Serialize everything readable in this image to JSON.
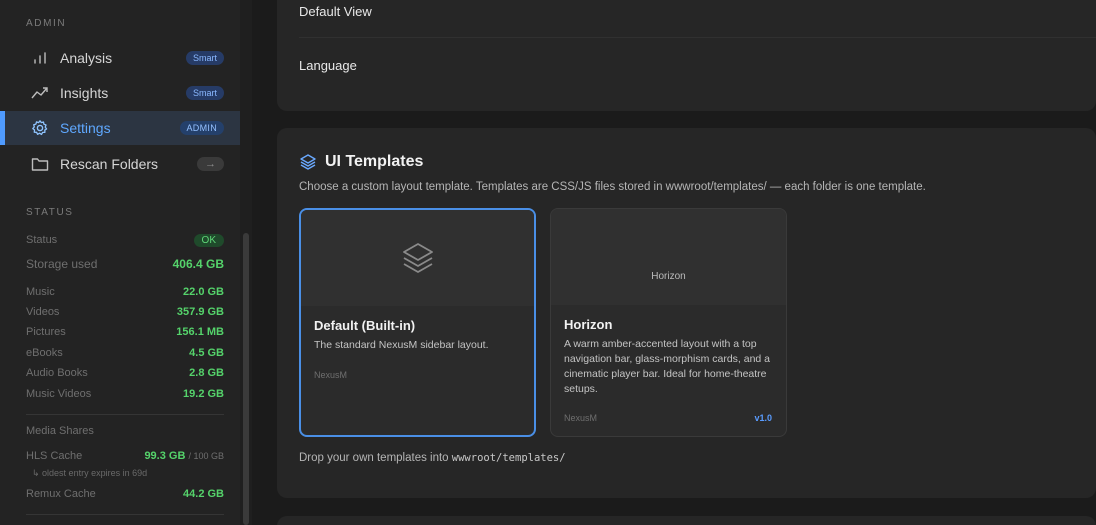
{
  "sidebar": {
    "admin_title": "ADMIN",
    "nav": [
      {
        "label": "Analysis",
        "badge": "Smart",
        "icon": "bar-chart-icon"
      },
      {
        "label": "Insights",
        "badge": "Smart",
        "icon": "trend-icon"
      },
      {
        "label": "Settings",
        "badge": "ADMIN",
        "icon": "gear-icon",
        "active": true
      },
      {
        "label": "Rescan Folders",
        "badge": "→",
        "icon": "folder-icon"
      }
    ],
    "status_title": "STATUS",
    "status": {
      "label": "Status",
      "value": "OK"
    },
    "storage": {
      "label": "Storage used",
      "value": "406.4 GB"
    },
    "breakdown": [
      {
        "label": "Music",
        "value": "22.0 GB"
      },
      {
        "label": "Videos",
        "value": "357.9 GB"
      },
      {
        "label": "Pictures",
        "value": "156.1 MB"
      },
      {
        "label": "eBooks",
        "value": "4.5 GB"
      },
      {
        "label": "Audio Books",
        "value": "2.8 GB"
      },
      {
        "label": "Music Videos",
        "value": "19.2 GB"
      }
    ],
    "media_shares": "Media Shares",
    "hls": {
      "label": "HLS Cache",
      "value": "99.3 GB",
      "limit": "/ 100 GB",
      "note": "↳ oldest entry expires in 69d"
    },
    "remux": {
      "label": "Remux Cache",
      "value": "44.2 GB"
    }
  },
  "settings": {
    "default_view_label": "Default View",
    "language_label": "Language"
  },
  "templates": {
    "title": "UI Templates",
    "description": "Choose a custom layout template. Templates are CSS/JS files stored in wwwroot/templates/ — each folder is one template.",
    "items": [
      {
        "name": "Default (Built-in)",
        "description": "The standard NexusM sidebar layout.",
        "author": "NexusM",
        "thumb": "",
        "selected": true
      },
      {
        "name": "Horizon",
        "description": "A warm amber-accented layout with a top navigation bar, glass-morphism cards, and a cinematic player bar. Ideal for home-theatre setups.",
        "author": "NexusM",
        "thumb": "Horizon",
        "version": "v1.0"
      }
    ],
    "drop_note_prefix": "Drop your own templates into",
    "drop_note_path": "wwwroot/templates/"
  },
  "colors": {
    "accent": "#4f9bff",
    "ok": "#55d36b",
    "background": "#1b1b1b",
    "card": "#262626"
  }
}
